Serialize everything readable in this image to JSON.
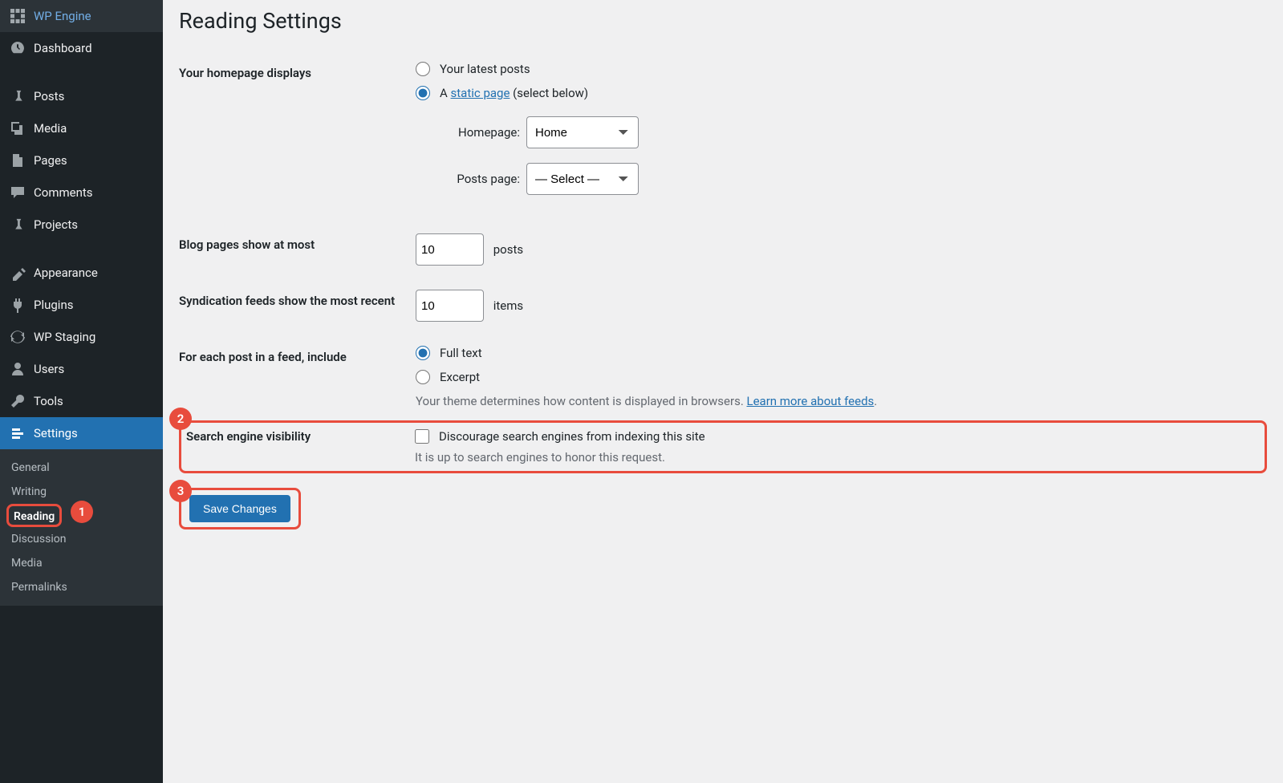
{
  "sidebar": {
    "items": [
      {
        "label": "WP Engine",
        "icon": "wpengine"
      },
      {
        "label": "Dashboard",
        "icon": "dashboard"
      },
      {
        "label": "Posts",
        "icon": "pin"
      },
      {
        "label": "Media",
        "icon": "media"
      },
      {
        "label": "Pages",
        "icon": "pages"
      },
      {
        "label": "Comments",
        "icon": "comment"
      },
      {
        "label": "Projects",
        "icon": "pin"
      },
      {
        "label": "Appearance",
        "icon": "appearance"
      },
      {
        "label": "Plugins",
        "icon": "plugin"
      },
      {
        "label": "WP Staging",
        "icon": "refresh"
      },
      {
        "label": "Users",
        "icon": "user"
      },
      {
        "label": "Tools",
        "icon": "tool"
      },
      {
        "label": "Settings",
        "icon": "settings"
      }
    ],
    "sub": [
      {
        "label": "General"
      },
      {
        "label": "Writing"
      },
      {
        "label": "Reading"
      },
      {
        "label": "Discussion"
      },
      {
        "label": "Media"
      },
      {
        "label": "Permalinks"
      }
    ]
  },
  "page_title": "Reading Settings",
  "homepage_th": "Your homepage displays",
  "radio_latest": "Your latest posts",
  "radio_static_prefix": "A ",
  "radio_static_link": "static page",
  "radio_static_suffix": " (select below)",
  "homepage_label": "Homepage:",
  "homepage_value": "Home",
  "postspage_label": "Posts page:",
  "postspage_value": "— Select —",
  "blog_pages_th": "Blog pages show at most",
  "blog_pages_value": "10",
  "blog_pages_unit": "posts",
  "syndication_th": "Syndication feeds show the most recent",
  "syndication_value": "10",
  "syndication_unit": "items",
  "feed_th": "For each post in a feed, include",
  "feed_full": "Full text",
  "feed_excerpt": "Excerpt",
  "feed_desc_prefix": "Your theme determines how content is displayed in browsers. ",
  "feed_desc_link": "Learn more about feeds",
  "sev_th": "Search engine visibility",
  "sev_check": "Discourage search engines from indexing this site",
  "sev_desc": "It is up to search engines to honor this request.",
  "save_label": "Save Changes",
  "badges": {
    "b1": "1",
    "b2": "2",
    "b3": "3"
  }
}
